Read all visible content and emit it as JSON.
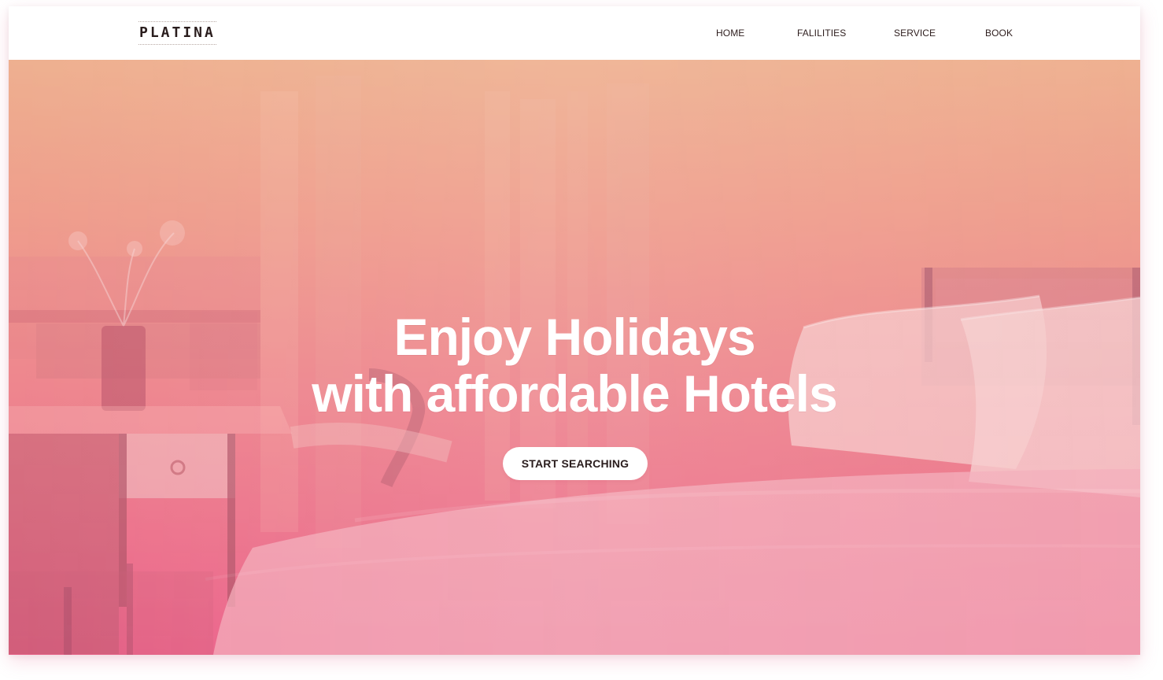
{
  "brand": {
    "logo": "PLATINA"
  },
  "nav": {
    "home": "HOME",
    "facilities": "FALILITIES",
    "service": "SERVICE",
    "book": "BOOK"
  },
  "hero": {
    "title_line1": "Enjoy Holidays",
    "title_line2": "with affordable Hotels",
    "cta": "START SEARCHING"
  },
  "colors": {
    "hero_top": "#eda884",
    "hero_bottom": "#eb6088",
    "text_dark": "#2d1d1d",
    "button_bg": "#ffffff"
  }
}
